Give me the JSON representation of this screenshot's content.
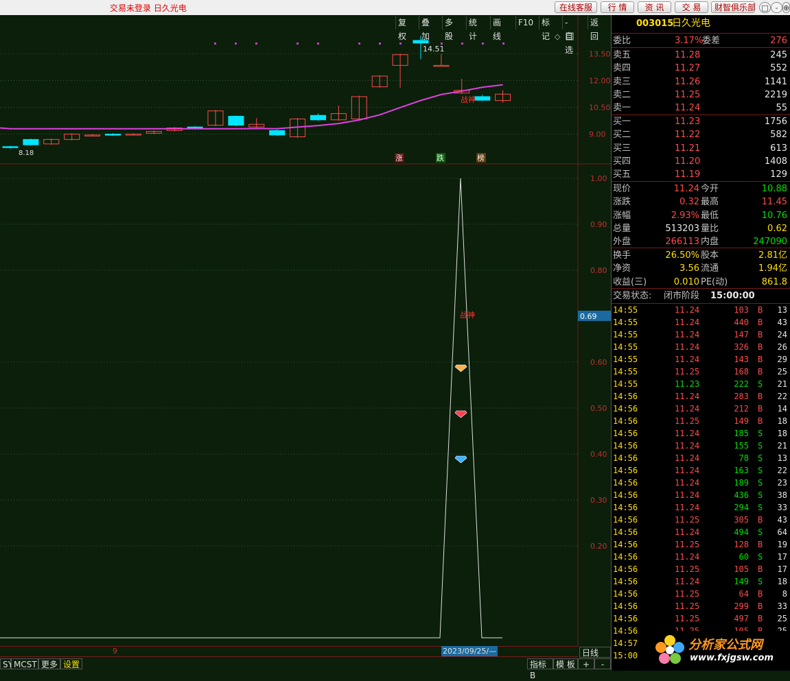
{
  "window": {
    "title": "交易未登录  日久光电",
    "buttons": [
      "在线客服",
      "行 情",
      "资 讯",
      "交 易",
      "财智俱乐部"
    ],
    "win_controls": [
      "□",
      "-",
      "⊕"
    ]
  },
  "toolbar": {
    "buttons": [
      "复权",
      "叠加",
      "多股",
      "统计",
      "画线",
      "F10",
      "标记",
      "-自选",
      "返回"
    ]
  },
  "kline": {
    "price_ticks": [
      "13.50",
      "12.00",
      "10.50",
      "9.00"
    ],
    "high_label": "14.51",
    "low_label": "8.18",
    "tag_label": "战神",
    "markers": [
      "涨",
      "跌",
      "榜"
    ]
  },
  "indicator": {
    "ticks": [
      "1.00",
      "0.90",
      "0.80",
      "0.60",
      "0.50",
      "0.40",
      "0.30",
      "0.20"
    ],
    "current_value": "0.69",
    "tag_label": "战神",
    "date_label": "2023/09/25/—",
    "axis_mark": "9"
  },
  "bottom": {
    "left_tabs": [
      "SY",
      "MCST",
      "更多",
      "设置"
    ],
    "right_tabs": [
      "指标B",
      "模 板",
      "+",
      "-"
    ],
    "period": "日线"
  },
  "stock": {
    "code": "003015",
    "name": "日久光电",
    "weibi_label": "委比",
    "weibi": "3.17%",
    "weicha_label": "委差",
    "weicha": "276",
    "asks": [
      {
        "label": "卖五",
        "price": "11.28",
        "vol": "245"
      },
      {
        "label": "卖四",
        "price": "11.27",
        "vol": "552"
      },
      {
        "label": "卖三",
        "price": "11.26",
        "vol": "1141"
      },
      {
        "label": "卖二",
        "price": "11.25",
        "vol": "2219"
      },
      {
        "label": "卖一",
        "price": "11.24",
        "vol": "55"
      }
    ],
    "bids": [
      {
        "label": "买一",
        "price": "11.23",
        "vol": "1756"
      },
      {
        "label": "买二",
        "price": "11.22",
        "vol": "582"
      },
      {
        "label": "买三",
        "price": "11.21",
        "vol": "613"
      },
      {
        "label": "买四",
        "price": "11.20",
        "vol": "1408"
      },
      {
        "label": "买五",
        "price": "11.19",
        "vol": "129"
      }
    ],
    "quote": [
      {
        "l1": "现价",
        "v1": "11.24",
        "l2": "今开",
        "v2": "10.88"
      },
      {
        "l1": "涨跌",
        "v1": "0.32",
        "l2": "最高",
        "v2": "11.45"
      },
      {
        "l1": "涨幅",
        "v1": "2.93%",
        "l2": "最低",
        "v2": "10.76"
      },
      {
        "l1": "总量",
        "v1": "513203",
        "l2": "量比",
        "v2": "0.62"
      },
      {
        "l1": "外盘",
        "v1": "266113",
        "l2": "内盘",
        "v2": "247090"
      }
    ],
    "fund": [
      {
        "l1": "换手",
        "v1": "26.50%",
        "l2": "股本",
        "v2": "2.81亿"
      },
      {
        "l1": "净资",
        "v1": "3.56",
        "l2": "流通",
        "v2": "1.94亿"
      },
      {
        "l1": "收益(三)",
        "v1": "0.010",
        "l2": "PE(动)",
        "v2": "861.8"
      }
    ],
    "status_label": "交易状态:",
    "status_value": "闭市阶段",
    "status_time": "15:00:00"
  },
  "ticks": [
    {
      "t": "14:55",
      "p": "11.24",
      "v": "103",
      "s": "B",
      "n": "13"
    },
    {
      "t": "14:55",
      "p": "11.24",
      "v": "440",
      "s": "B",
      "n": "43"
    },
    {
      "t": "14:55",
      "p": "11.24",
      "v": "147",
      "s": "B",
      "n": "24"
    },
    {
      "t": "14:55",
      "p": "11.24",
      "v": "326",
      "s": "B",
      "n": "26"
    },
    {
      "t": "14:55",
      "p": "11.24",
      "v": "143",
      "s": "B",
      "n": "29"
    },
    {
      "t": "14:55",
      "p": "11.25",
      "v": "168",
      "s": "B",
      "n": "25"
    },
    {
      "t": "14:55",
      "p": "11.23",
      "v": "222",
      "s": "S",
      "n": "21"
    },
    {
      "t": "14:56",
      "p": "11.24",
      "v": "283",
      "s": "B",
      "n": "22"
    },
    {
      "t": "14:56",
      "p": "11.24",
      "v": "212",
      "s": "B",
      "n": "14"
    },
    {
      "t": "14:56",
      "p": "11.25",
      "v": "149",
      "s": "B",
      "n": "18"
    },
    {
      "t": "14:56",
      "p": "11.24",
      "v": "185",
      "s": "S",
      "n": "18"
    },
    {
      "t": "14:56",
      "p": "11.24",
      "v": "155",
      "s": "S",
      "n": "21"
    },
    {
      "t": "14:56",
      "p": "11.24",
      "v": "78",
      "s": "S",
      "n": "13"
    },
    {
      "t": "14:56",
      "p": "11.24",
      "v": "163",
      "s": "S",
      "n": "22"
    },
    {
      "t": "14:56",
      "p": "11.24",
      "v": "189",
      "s": "S",
      "n": "23"
    },
    {
      "t": "14:56",
      "p": "11.24",
      "v": "436",
      "s": "S",
      "n": "38"
    },
    {
      "t": "14:56",
      "p": "11.24",
      "v": "294",
      "s": "S",
      "n": "33"
    },
    {
      "t": "14:56",
      "p": "11.25",
      "v": "305",
      "s": "B",
      "n": "43"
    },
    {
      "t": "14:56",
      "p": "11.24",
      "v": "494",
      "s": "S",
      "n": "64"
    },
    {
      "t": "14:56",
      "p": "11.25",
      "v": "128",
      "s": "B",
      "n": "19"
    },
    {
      "t": "14:56",
      "p": "11.24",
      "v": "60",
      "s": "S",
      "n": "17"
    },
    {
      "t": "14:56",
      "p": "11.25",
      "v": "105",
      "s": "B",
      "n": "17"
    },
    {
      "t": "14:56",
      "p": "11.24",
      "v": "149",
      "s": "S",
      "n": "18"
    },
    {
      "t": "14:56",
      "p": "11.25",
      "v": "64",
      "s": "B",
      "n": "8"
    },
    {
      "t": "14:56",
      "p": "11.25",
      "v": "299",
      "s": "B",
      "n": "33"
    },
    {
      "t": "14:56",
      "p": "11.25",
      "v": "497",
      "s": "B",
      "n": "25"
    },
    {
      "t": "14:56",
      "p": "11.25",
      "v": "105",
      "s": "B",
      "n": "25"
    },
    {
      "t": "14:57",
      "p": "11.24",
      "v": "",
      "s": "",
      "n": ""
    },
    {
      "t": "15:00",
      "p": "",
      "v": "",
      "s": "",
      "n": ""
    }
  ],
  "watermark": {
    "name": "分析家公式网",
    "url": "www.fxjgsw.com"
  },
  "colors": {
    "up": "#ff4b4b",
    "down": "#00e5ff",
    "ma": "#e040e0",
    "background": "#0b1f0b",
    "panel": "#000000"
  },
  "chart_data": {
    "type": "candlestick",
    "price_axis": [
      8.18,
      14.51
    ],
    "candles": [
      {
        "o": 8.3,
        "c": 8.25,
        "h": 8.35,
        "l": 8.18,
        "dir": "down"
      },
      {
        "o": 8.4,
        "c": 8.7,
        "h": 8.75,
        "l": 8.35,
        "dir": "down"
      },
      {
        "o": 8.45,
        "c": 8.7,
        "h": 8.75,
        "l": 8.4,
        "dir": "up"
      },
      {
        "o": 8.7,
        "c": 9.0,
        "h": 9.05,
        "l": 8.65,
        "dir": "up"
      },
      {
        "o": 8.95,
        "c": 8.95,
        "h": 9.0,
        "l": 8.9,
        "dir": "up"
      },
      {
        "o": 9.0,
        "c": 8.95,
        "h": 9.05,
        "l": 8.9,
        "dir": "down"
      },
      {
        "o": 9.0,
        "c": 9.0,
        "h": 9.05,
        "l": 8.95,
        "dir": "up"
      },
      {
        "o": 9.05,
        "c": 9.15,
        "h": 9.2,
        "l": 9.0,
        "dir": "up"
      },
      {
        "o": 9.2,
        "c": 9.35,
        "h": 9.4,
        "l": 9.15,
        "dir": "up"
      },
      {
        "o": 9.4,
        "c": 9.35,
        "h": 9.45,
        "l": 9.3,
        "dir": "down"
      },
      {
        "o": 9.5,
        "c": 10.3,
        "h": 10.35,
        "l": 9.45,
        "dir": "up"
      },
      {
        "o": 10.0,
        "c": 9.5,
        "h": 10.05,
        "l": 9.45,
        "dir": "down"
      },
      {
        "o": 9.4,
        "c": 9.55,
        "h": 9.9,
        "l": 9.35,
        "dir": "up"
      },
      {
        "o": 9.2,
        "c": 8.95,
        "h": 9.25,
        "l": 8.9,
        "dir": "down"
      },
      {
        "o": 8.85,
        "c": 9.85,
        "h": 9.9,
        "l": 8.8,
        "dir": "up"
      },
      {
        "o": 10.05,
        "c": 9.8,
        "h": 10.15,
        "l": 9.75,
        "dir": "down"
      },
      {
        "o": 9.8,
        "c": 10.15,
        "h": 10.6,
        "l": 9.75,
        "dir": "up"
      },
      {
        "o": 9.85,
        "c": 11.1,
        "h": 11.15,
        "l": 9.8,
        "dir": "up"
      },
      {
        "o": 11.65,
        "c": 12.25,
        "h": 12.3,
        "l": 11.6,
        "dir": "up"
      },
      {
        "o": 12.85,
        "c": 13.45,
        "h": 13.5,
        "l": 11.6,
        "dir": "up"
      },
      {
        "o": 14.1,
        "c": 14.25,
        "h": 14.51,
        "l": 13.2,
        "dir": "down"
      },
      {
        "o": 12.85,
        "c": 12.85,
        "h": 13.5,
        "l": 12.85,
        "dir": "up"
      },
      {
        "o": 11.3,
        "c": 11.45,
        "h": 12.1,
        "l": 11.25,
        "dir": "up"
      },
      {
        "o": 10.9,
        "c": 11.1,
        "h": 11.2,
        "l": 10.85,
        "dir": "down"
      },
      {
        "o": 10.88,
        "c": 11.24,
        "h": 11.45,
        "l": 10.76,
        "dir": "up"
      }
    ],
    "indicator": {
      "ticks": [
        1.0,
        0.9,
        0.8,
        0.6,
        0.5,
        0.4,
        0.3,
        0.2
      ],
      "current": 0.69,
      "peak": 1.0
    }
  }
}
